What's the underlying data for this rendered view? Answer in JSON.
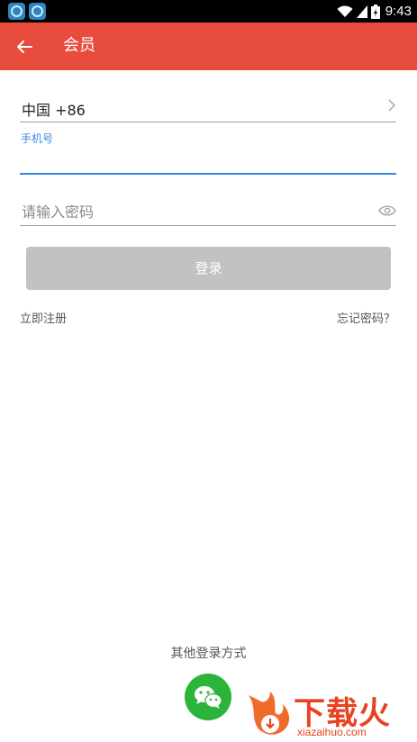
{
  "status_bar": {
    "time": "9:43",
    "icons": [
      "app-notification-icon",
      "app-notification-icon",
      "wifi-icon",
      "signal-icon",
      "battery-icon"
    ]
  },
  "toolbar": {
    "back_icon": "arrow-left-icon",
    "title": "会员",
    "background": "#e84c3d"
  },
  "form": {
    "country_code": "中国 +86",
    "phone_label": "手机号",
    "phone_value": "",
    "password_placeholder": "请输入密码",
    "password_value": "",
    "login_button": "登录",
    "register_link": "立即注册",
    "forgot_link": "忘记密码？",
    "accent_color": "#3b87e4"
  },
  "other_login": {
    "label": "其他登录方式",
    "providers": [
      "wechat-icon"
    ]
  },
  "watermark": {
    "title": "下载火",
    "subtitle": "xiazaihuo.com"
  }
}
